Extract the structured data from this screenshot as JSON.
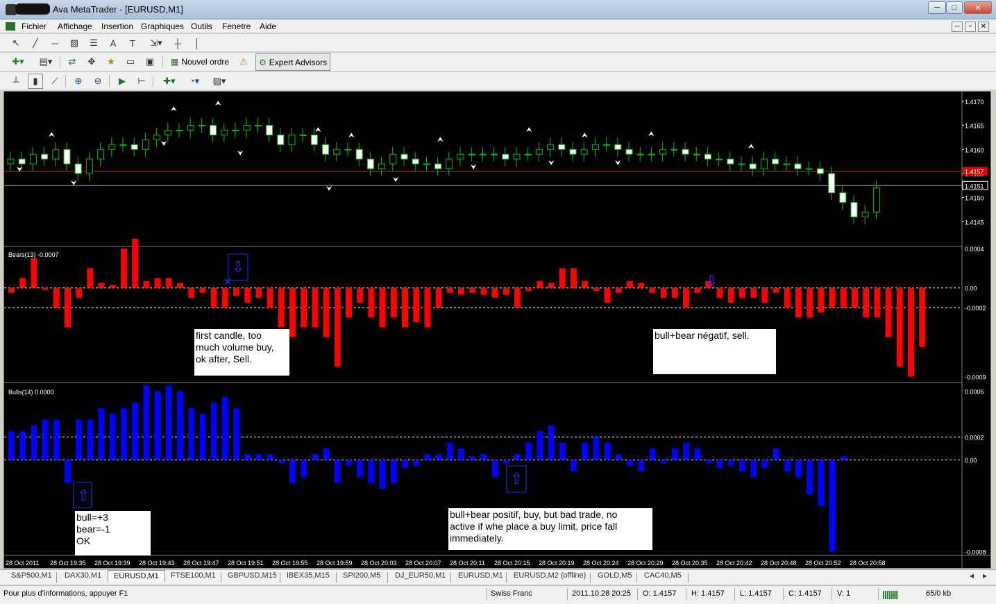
{
  "window": {
    "title": "Ava MetaTrader - [EURUSD,M1]",
    "controls": [
      "─",
      "□",
      "✕"
    ],
    "mdi_controls": [
      "─",
      "▫",
      "✕"
    ]
  },
  "menu": [
    "Fichier",
    "Affichage",
    "Insertion",
    "Graphiques",
    "Outils",
    "Fenetre",
    "Aide"
  ],
  "toolbar": {
    "new_order": "Nouvel ordre",
    "expert_advisors": "Expert Advisors"
  },
  "icons": [
    "cursor-icon",
    "line-icon",
    "hline-icon",
    "channel-icon",
    "fibo-icon",
    "text-icon",
    "label-icon",
    "arrow-icon",
    "crosshair-icon",
    "vline-icon",
    "new-chart-icon",
    "profiles-icon",
    "market-watch-icon",
    "navigator-icon",
    "favorites-icon",
    "terminal-icon",
    "tester-icon",
    "bar-chart-icon",
    "candle-chart-icon",
    "line-chart-icon",
    "zoom-in-icon",
    "zoom-out-icon",
    "autoscroll-icon",
    "chart-shift-icon",
    "indicators-icon",
    "periods-icon",
    "templates-icon"
  ],
  "main_chart": {
    "price_axis": [
      "1.4170",
      "1.4165",
      "1.4160",
      "1.4155",
      "1.4150",
      "1.4145"
    ],
    "bid_label": "1.4157",
    "ask_label": "1.4151",
    "hline_red_color": "#e00000",
    "hline_gray_color": "#8fa0b0"
  },
  "bears_panel": {
    "label": "Bears(13) -0.0007",
    "axis": [
      "0.0004",
      "0.00",
      "-0.0002",
      "-0.0009"
    ],
    "color": "#ff0000"
  },
  "bulls_panel": {
    "label": "Bulls(14) 0.0000",
    "axis": [
      "0.0006",
      "0.0002",
      "0.00",
      "-0.0008"
    ],
    "color": "#0000ff"
  },
  "time_axis": [
    "28 Oct 2011",
    "28 Oct 19:35",
    "28 Oct 19:39",
    "28 Oct 19:43",
    "28 Oct 19:47",
    "28 Oct 19:51",
    "28 Oct 19:55",
    "28 Oct 19:59",
    "28 Oct 20:03",
    "28 Oct 20:07",
    "28 Oct 20:11",
    "28 Oct 20:15",
    "28 Oct 20:19",
    "28 Oct 20:24",
    "28 Oct 20:29",
    "28 Oct 20:35",
    "28 Oct 20:42",
    "28 Oct 20:48",
    "28 Oct 20:52",
    "28 Oct 20:58"
  ],
  "notes": {
    "first_candle": "first candle, too\nmuch volume buy,\nok after, Sell.",
    "negatif": "bull+bear négatif, sell.",
    "bull_bear_ok": "bull=+3\nbear=-1\nOK",
    "positif": "bull+bear positif, buy, but bad trade, no\nactive if whe place a buy limit, price fall\nimmediately."
  },
  "tabs": [
    "S&P500,M1",
    "DAX30,M1",
    "EURUSD,M1",
    "FTSE100,M1",
    "GBPUSD,M15",
    "IBEX35,M15",
    "SPI200,M5",
    "DJ_EUR50,M1",
    "EURUSD,M1",
    "EURUSD,M2 (offline)",
    "GOLD,M5",
    "CAC40,M5"
  ],
  "active_tab_index": 2,
  "status": {
    "help": "Pour plus d'informations, appuyer F1",
    "profile": "Swiss Franc",
    "datetime": "2011.10.28 20:25",
    "open": "O: 1.4157",
    "high": "H: 1.4157",
    "low": "L: 1.4157",
    "close": "C: 1.4157",
    "volume": "V: 1",
    "traffic": "65/0 kb"
  },
  "chart_data": {
    "type": "bar",
    "bears": [
      -5e-05,
      0.0001,
      0.0003,
      -2e-05,
      -0.0002,
      -0.0004,
      -0.0001,
      0.0002,
      5e-05,
      3e-05,
      0.0004,
      0.0005,
      7e-05,
      0.0001,
      0.0001,
      5e-05,
      -0.0001,
      -5e-05,
      -0.0002,
      -0.0002,
      -8e-05,
      -0.00015,
      -0.0001,
      -0.0002,
      -0.0004,
      -0.0005,
      -0.0004,
      -0.0004,
      -0.0005,
      -0.0008,
      -0.0003,
      -0.00015,
      -0.0003,
      -0.0004,
      -0.0003,
      -0.0004,
      -0.00035,
      -0.0004,
      -0.0002,
      -5e-05,
      -7e-05,
      -5e-05,
      -7e-05,
      -0.0001,
      -7e-05,
      -0.0002,
      -3e-05,
      7e-05,
      5e-05,
      0.0002,
      0.0002,
      7e-05,
      -3e-05,
      -0.00015,
      -5e-05,
      7e-05,
      5e-05,
      -5e-05,
      -0.0001,
      -0.0001,
      -0.0002,
      -5e-05,
      7e-05,
      -0.0001,
      -0.00015,
      -0.0001,
      -0.0001,
      -0.00015,
      -5e-05,
      -0.0002,
      -0.0003,
      -0.0003,
      -0.00025,
      -0.0002,
      -0.0002,
      -0.0002,
      -0.0003,
      -0.0003,
      -0.0005,
      -0.0008,
      -0.0009,
      -0.0006
    ],
    "bulls": [
      0.00025,
      0.00025,
      0.0003,
      0.00035,
      0.00035,
      -0.0002,
      0.00035,
      0.00035,
      0.00045,
      0.0004,
      0.00045,
      0.0005,
      0.00065,
      0.0006,
      0.00065,
      0.0006,
      0.00045,
      0.0004,
      0.0005,
      0.00055,
      0.00045,
      5e-05,
      5e-05,
      5e-05,
      -3e-05,
      -0.0002,
      -0.00015,
      5e-05,
      0.0001,
      -0.0002,
      -5e-05,
      -0.00015,
      -0.0002,
      -0.00025,
      -0.0002,
      -7e-05,
      -5e-05,
      5e-05,
      5e-05,
      0.00015,
      0.0001,
      3e-05,
      5e-05,
      -0.00015,
      -3e-05,
      5e-05,
      0.00015,
      0.00025,
      0.0003,
      0.00015,
      -0.0001,
      0.00015,
      0.0002,
      0.00015,
      5e-05,
      -5e-05,
      -0.0001,
      0.0001,
      -3e-05,
      0.0001,
      0.00015,
      0.0001,
      -3e-05,
      -7e-05,
      -5e-05,
      -0.0001,
      -0.00015,
      -7e-05,
      0.0001,
      -0.0001,
      -0.00015,
      -0.0003,
      -0.0004,
      -0.0008,
      3e-05
    ]
  }
}
